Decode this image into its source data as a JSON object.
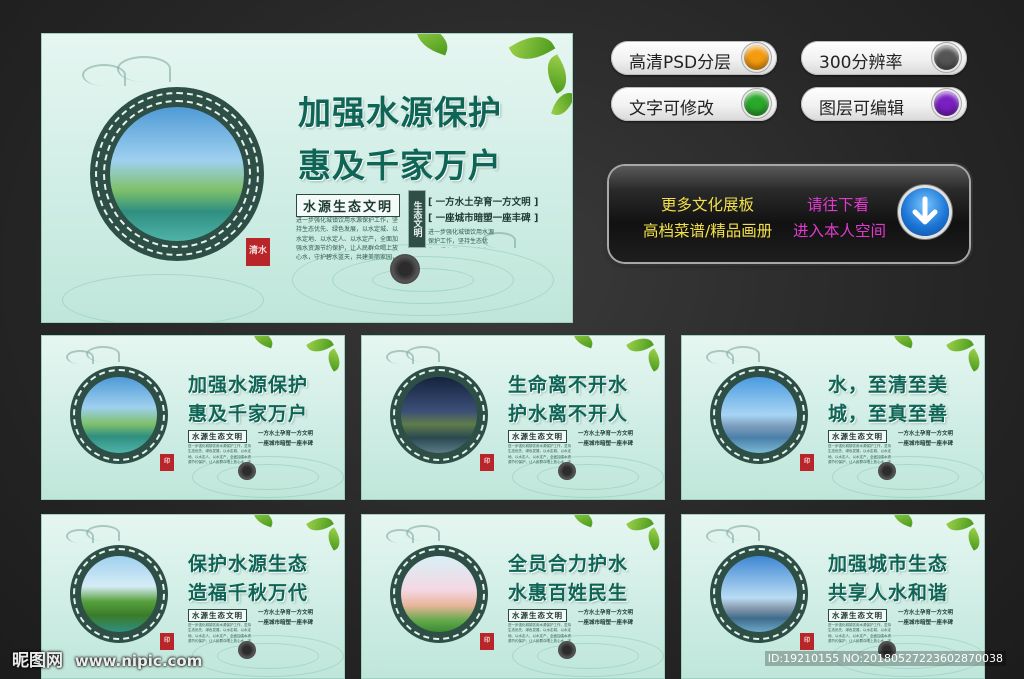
{
  "main_board": {
    "title_line1": "加强水源保护",
    "title_line2": "惠及千家万户",
    "tag": "水源生态文明",
    "motto1": "[ 一方水土孕育一方文明 ]",
    "motto2": "[ 一座城市暗塑一座丰碑 ]",
    "body": "进一步强化城镇饮用水源保护工作，坚持生态优先、绿色发展，以水定城、以水定地、以水定人、以水定产，全面加强水资源节约保护，让人民群众喝上放心水，守护碧水蓝天，共建美丽家园，实现人与自然和谐共生，为子孙后代留下绿水青山。",
    "vertical_seal": "生态文明",
    "seal": "清水"
  },
  "features": [
    {
      "label": "高清PSD分层",
      "color": "#f59b0f"
    },
    {
      "label": "300分辨率",
      "color": "#555555"
    },
    {
      "label": "文字可修改",
      "color": "#2aa82a"
    },
    {
      "label": "图层可编辑",
      "color": "#7a1fc2"
    }
  ],
  "promo": {
    "line1": "更多文化展板",
    "line2": "高档菜谱/精品画册",
    "line3": "请往下看",
    "line4": "进入本人空间"
  },
  "thumbnails": [
    {
      "title1": "加强水源保护",
      "title2": "惠及千家万户",
      "tag": "水源生态文明",
      "scene": "lake"
    },
    {
      "title1": "生命离不开水",
      "title2": "护水离不开人",
      "tag": "水源生态文明",
      "scene": "night"
    },
    {
      "title1": "水，至清至美",
      "title2": "城，至真至善",
      "tag": "水源生态文明",
      "scene": "city"
    },
    {
      "title1": "保护水源生态",
      "title2": "造福千秋万代",
      "tag": "水源生态文明",
      "scene": "field"
    },
    {
      "title1": "全员合力护水",
      "title2": "水惠百姓民生",
      "tag": "水源生态文明",
      "scene": "hand"
    },
    {
      "title1": "加强城市生态",
      "title2": "共享人水和谐",
      "tag": "水源生态文明",
      "scene": "sky"
    }
  ],
  "thumb_mottos": [
    "一方水土孕育一方文明",
    "一座城市暗塑一座丰碑"
  ],
  "watermark": {
    "site": "昵图网",
    "url": "www.nipic.com",
    "id": "ID:19210155 NO:20180527223602870038"
  }
}
